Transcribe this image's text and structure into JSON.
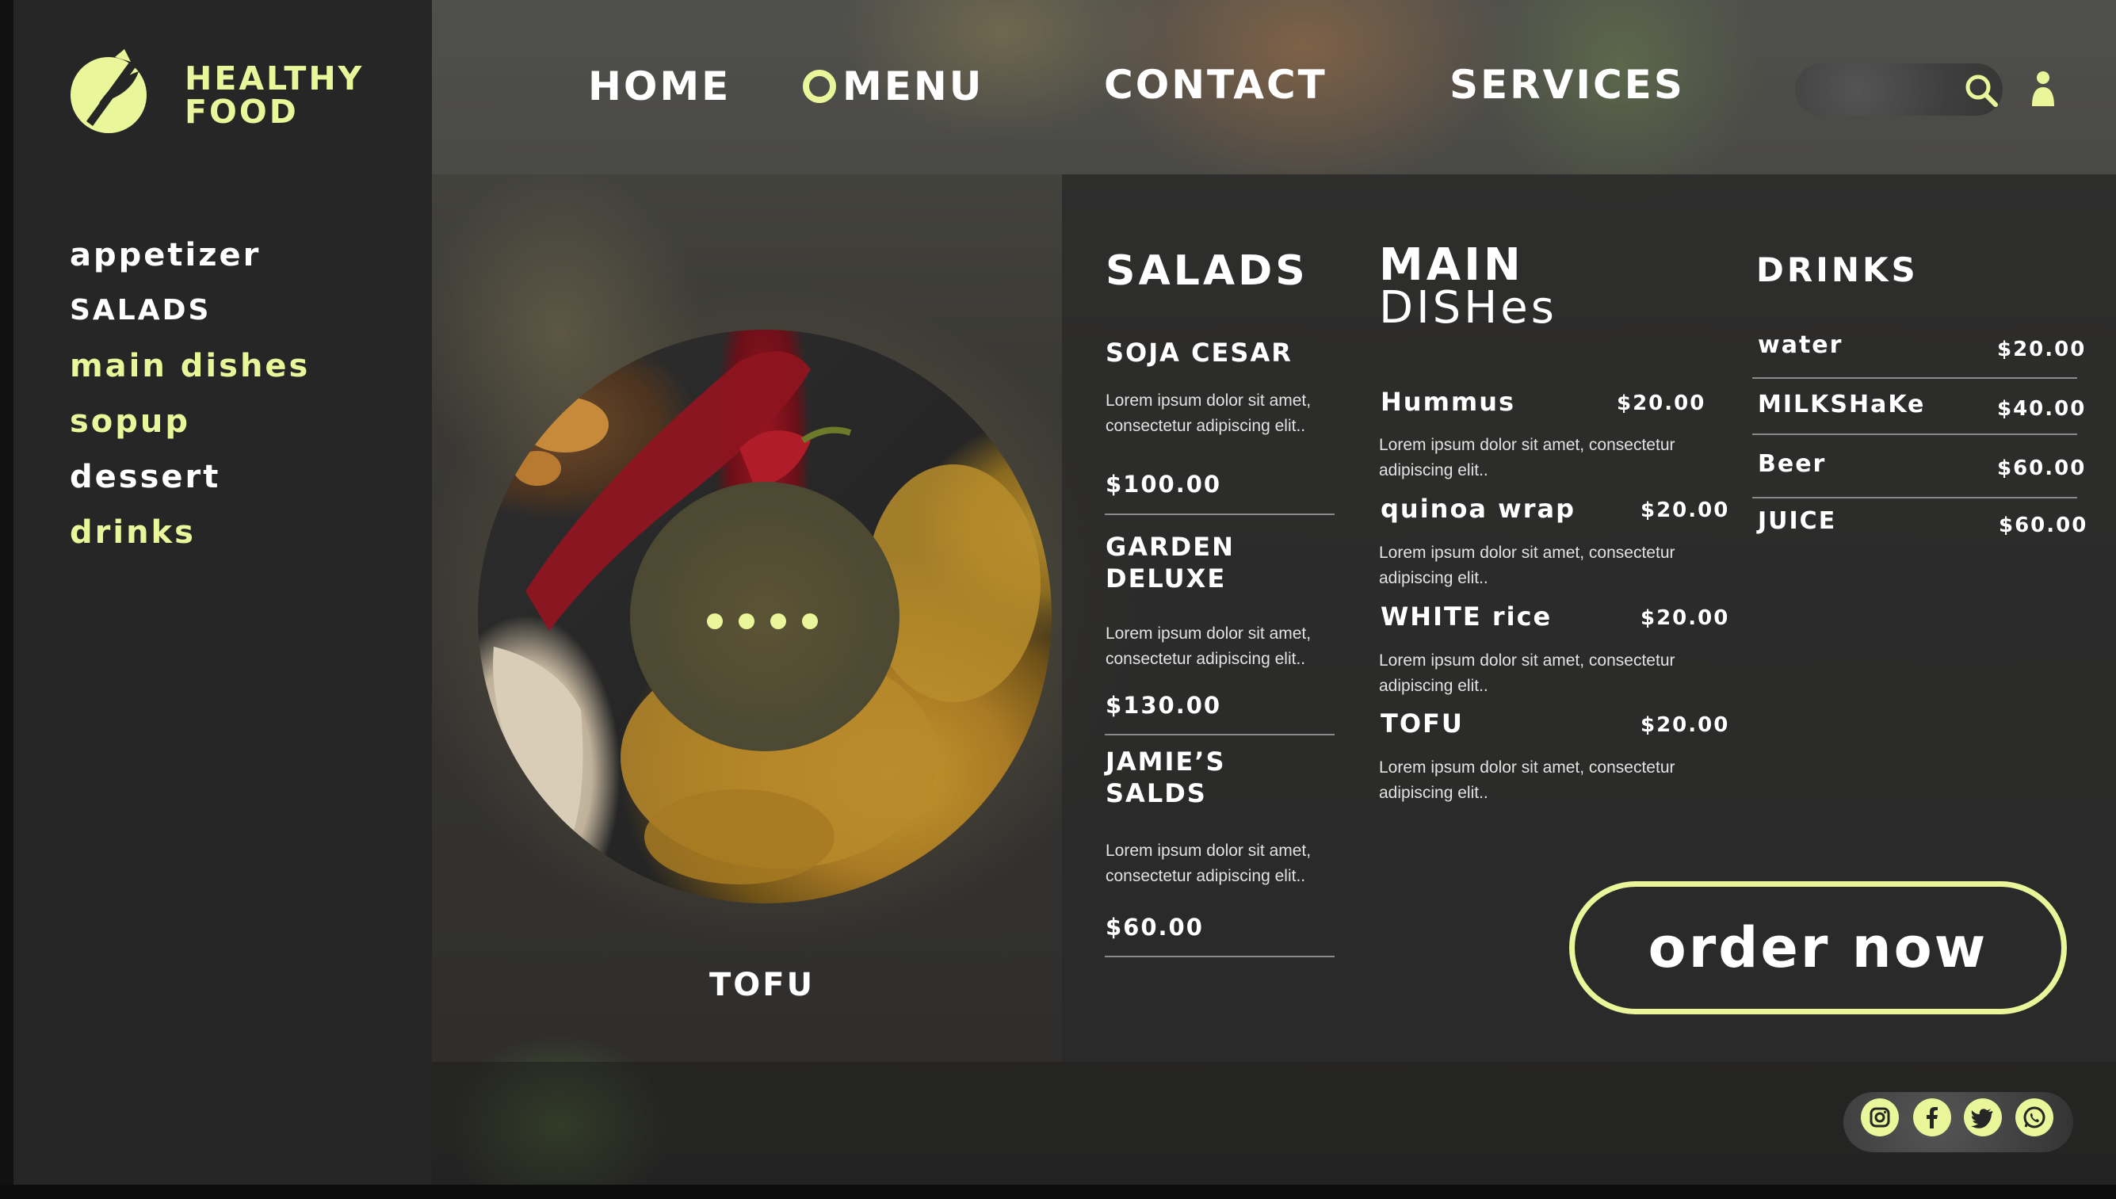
{
  "brand": {
    "line1": "HEALTHY",
    "line2": "FOOD",
    "accent": "#e9f69a",
    "logo_icon": "leaf-icon"
  },
  "sidebar": {
    "items": [
      {
        "label": "appetizer",
        "color": "#ffffff"
      },
      {
        "label": "SALADS",
        "color": "#ffffff"
      },
      {
        "label": "main dishes",
        "color": "#e9f69a"
      },
      {
        "label": "sopup",
        "color": "#e9f69a"
      },
      {
        "label": "dessert",
        "color": "#ffffff"
      },
      {
        "label": "drinks",
        "color": "#e9f69a"
      }
    ]
  },
  "nav": {
    "home": "HOME",
    "menu": "MENU",
    "contact": "CONTACT",
    "services": "SERVICES",
    "search_icon": "search-icon",
    "user_icon": "user-icon"
  },
  "hero": {
    "dish_label": "TOFU",
    "carousel_dots": 4
  },
  "salads": {
    "title": "SALADS",
    "items": [
      {
        "name": "SOJA CESAR",
        "desc": "Lorem ipsum dolor sit amet, consectetur adipiscing elit..",
        "price": "$100.00"
      },
      {
        "name_line1": "GARDEN",
        "name_line2": "DELUXE",
        "desc": "Lorem ipsum dolor sit amet, consectetur adipiscing elit..",
        "price": "$130.00"
      },
      {
        "name_line1": "JAMIE’S",
        "name_line2": "SALDS",
        "desc": "Lorem ipsum dolor sit amet, consectetur adipiscing elit..",
        "price": "$60.00"
      }
    ]
  },
  "main_dishes": {
    "title_line1": "MAIN",
    "title_line2": "DISHes",
    "items": [
      {
        "name": "Hummus",
        "price": "$20.00",
        "desc": "Lorem ipsum dolor sit amet, consectetur adipiscing elit.."
      },
      {
        "name": "quinoa wrap",
        "price": "$20.00",
        "desc": "Lorem ipsum dolor sit amet, consectetur adipiscing elit.."
      },
      {
        "name": "WHITE rice",
        "price": "$20.00",
        "desc": "Lorem ipsum dolor sit amet, consectetur adipiscing elit.."
      },
      {
        "name": "TOFU",
        "price": "$20.00",
        "desc": "Lorem ipsum dolor sit amet, consectetur adipiscing elit.."
      }
    ]
  },
  "drinks": {
    "title": "DRINKS",
    "items": [
      {
        "name": "water",
        "price": "$20.00"
      },
      {
        "name": "MILKSHaKe",
        "price": "$40.00"
      },
      {
        "name": "Beer",
        "price": "$60.00"
      },
      {
        "name": "JUICE",
        "price": "$60.00"
      }
    ]
  },
  "cta": {
    "order_label": "order now"
  },
  "social": {
    "icons": [
      "instagram-icon",
      "facebook-icon",
      "twitter-icon",
      "whatsapp-icon"
    ]
  }
}
